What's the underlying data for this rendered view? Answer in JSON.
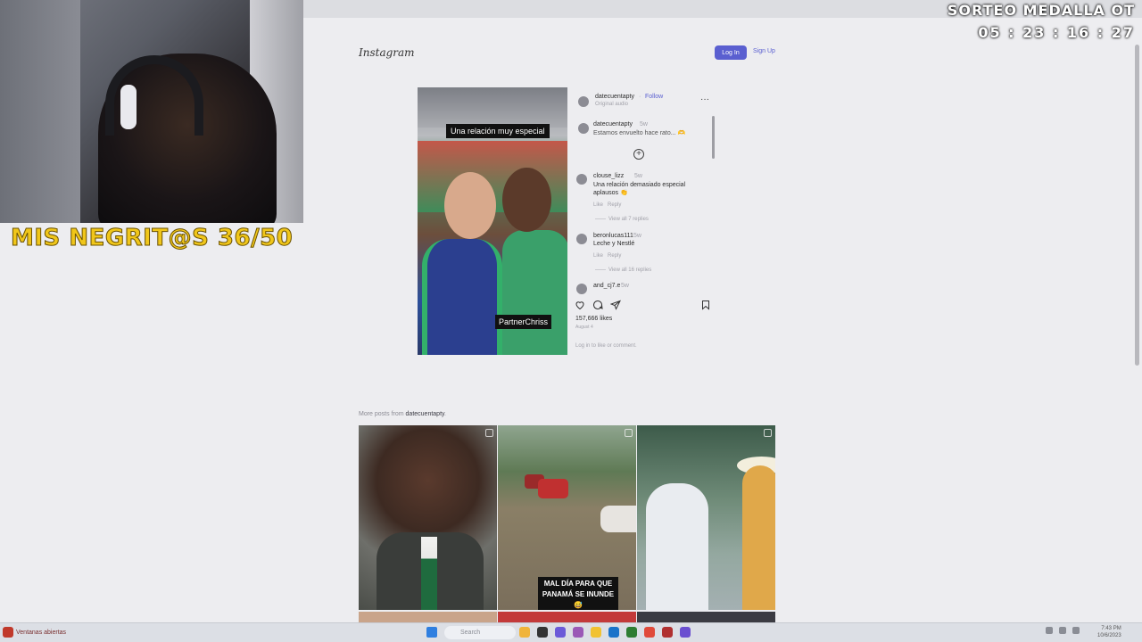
{
  "overlay": {
    "stream_label": "MIS NEGRIT@S 36/50",
    "sorteo_title": "SORTEO MEDALLA OT",
    "sorteo_timer": "05 : 23 : 16 : 27"
  },
  "instagram": {
    "logo": "Instagram",
    "login_label": "Log In",
    "signup_label": "Sign Up",
    "post": {
      "author": "datecuentapty",
      "follow_label": "Follow",
      "audio": "Original audio",
      "caption_author": "datecuentapty",
      "caption_time": "5w",
      "caption_text": "Estamos envuelto hace rato... 🫶",
      "media_caption_top": "Una relación muy especial",
      "media_caption_bottom": "PartnerChriss",
      "comments": [
        {
          "user": "clouse_lizz",
          "time": "5w",
          "text": "Una relación demasiado especial aplausos 👏",
          "like": "Like",
          "reply": "Reply",
          "view_replies": "View all 7 replies"
        },
        {
          "user": "beronlucas111",
          "time": "5w",
          "text": "Leche y Nestlé",
          "like": "Like",
          "reply": "Reply",
          "view_replies": "View all 16 replies"
        },
        {
          "user": "and_cj7.e",
          "time": "5w",
          "text": ""
        }
      ],
      "likes": "157,666 likes",
      "date": "August 4",
      "login_prompt": "Log in to like or comment."
    },
    "more_posts": {
      "label": "More posts from",
      "author": "datecuentapty",
      "tile2_caption": "MAL DÍA PARA QUE PANAMÁ SE INUNDE 😅"
    }
  },
  "taskbar": {
    "app_label": "Ventanas abiertas",
    "search_placeholder": "Search",
    "clock_time": "7:43 PM",
    "clock_date": "10/6/2023"
  }
}
